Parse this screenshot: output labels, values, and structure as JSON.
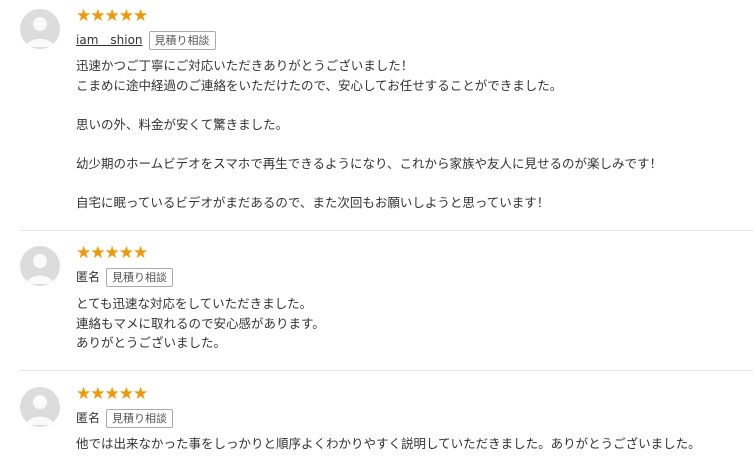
{
  "reviews": [
    {
      "stars": "★★★★★",
      "rating": 5,
      "author": "iam＿shion",
      "tag": "見積り相談",
      "lines": [
        "迅速かつご丁寧にご対応いただきありがとうございました！",
        "こまめに途中経過のご連絡をいただけたので、安心してお任せすることができました。",
        "",
        "思いの外、料金が安くて驚きました。",
        "",
        "幼少期のホームビデオをスマホで再生できるようになり、これから家族や友人に見せるのが楽しみです！",
        "",
        "自宅に眠っているビデオがまだあるので、また次回もお願いしようと思っています！"
      ]
    },
    {
      "stars": "★★★★★",
      "rating": 5,
      "author": "匿名",
      "tag": "見積り相談",
      "lines": [
        "とても迅速な対応をしていただきました。",
        "連絡もマメに取れるので安心感があります。",
        "ありがとうございました。"
      ]
    },
    {
      "stars": "★★★★★",
      "rating": 5,
      "author": "匿名",
      "tag": "見積り相談",
      "lines": [
        "他では出来なかった事をしっかりと順序よくわかりやすく説明していただきました。ありがとうございました。"
      ]
    }
  ],
  "colors": {
    "star": "#f39800",
    "avatar": "#dcdcdc",
    "divider": "#e6e6e6"
  },
  "icons": {
    "avatar": "default-user-avatar-icon",
    "star": "star-icon"
  }
}
